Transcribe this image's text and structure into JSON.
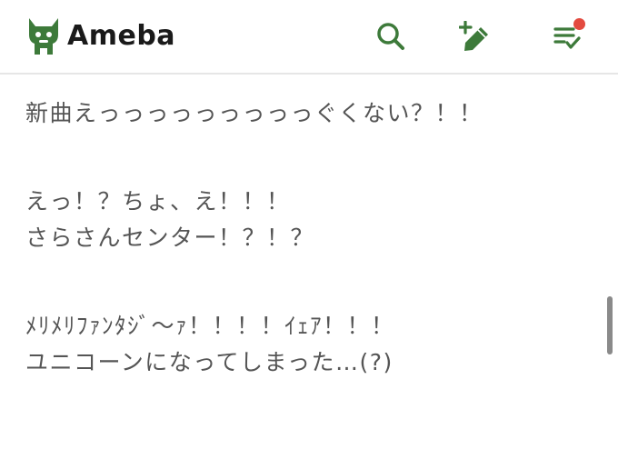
{
  "header": {
    "brand": "Ameba",
    "brand_color": "#3d7a3a",
    "icons": [
      "search-icon",
      "write-post-icon",
      "notifications-icon"
    ],
    "notification_dot_color": "#e34a3f"
  },
  "article": {
    "lines": [
      "新曲えっっっっっっっっっぐくない？！！",
      "えっ！？ちょ、え！！！",
      "さらさんセンター！？！？",
      "ﾒﾘﾒﾘﾌｧﾝﾀｼﾞ～ｧ！！！！ｲｪｱ！！！",
      "ユニコーンになってしまった…(?)"
    ]
  }
}
